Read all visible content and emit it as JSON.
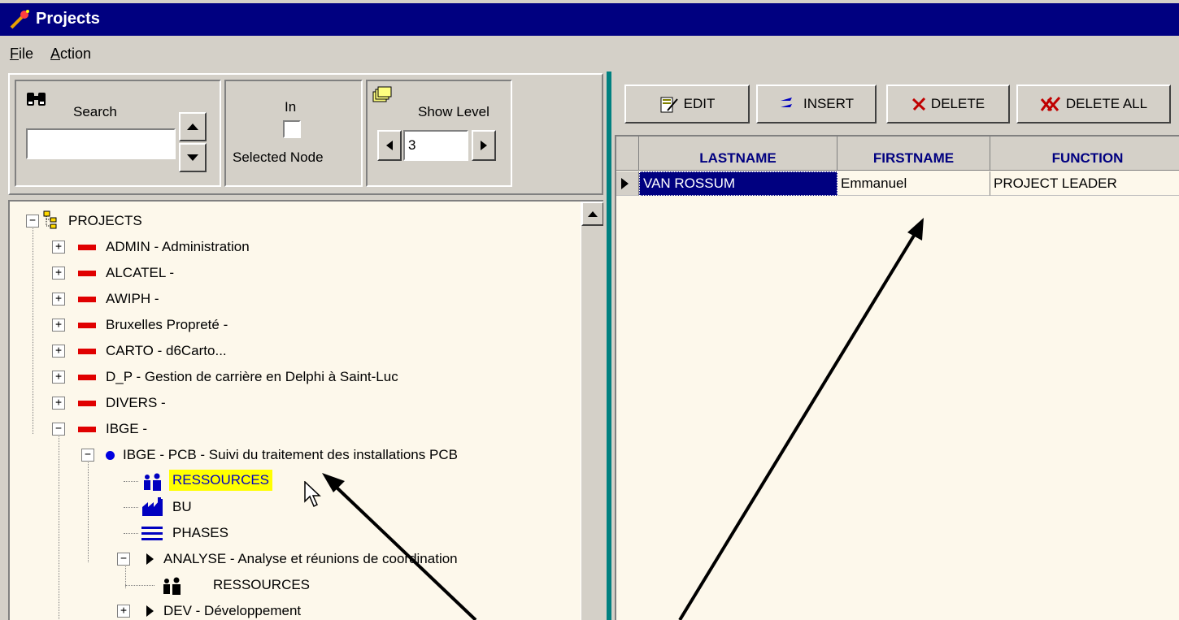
{
  "window": {
    "title": "Projects"
  },
  "menu": {
    "file": "File",
    "file_ul": "F",
    "file_rest": "ile",
    "action": "Action",
    "action_ul": "A",
    "action_rest": "ction"
  },
  "search": {
    "label": "Search",
    "value": ""
  },
  "in_selected": {
    "label_in": "In",
    "label_node": "Selected Node",
    "checked": false
  },
  "show_level": {
    "label": "Show Level",
    "value": "3"
  },
  "toolbar": {
    "edit": "EDIT",
    "insert": "INSERT",
    "delete": "DELETE",
    "delete_all": "DELETE ALL"
  },
  "grid": {
    "columns": [
      "LASTNAME",
      "FIRSTNAME",
      "FUNCTION"
    ],
    "rows": [
      {
        "lastname": "VAN ROSSUM",
        "firstname": "Emmanuel",
        "function": "PROJECT LEADER"
      }
    ]
  },
  "tree": {
    "root": "PROJECTS",
    "items": [
      {
        "label": "ADMIN - Administration"
      },
      {
        "label": "ALCATEL -"
      },
      {
        "label": "AWIPH -"
      },
      {
        "label": "Bruxelles Propreté -"
      },
      {
        "label": "CARTO - d6Carto..."
      },
      {
        "label": "D_P - Gestion de carrière en Delphi à Saint-Luc"
      },
      {
        "label": "DIVERS -"
      },
      {
        "label": "IBGE -"
      }
    ],
    "sub_project": "IBGE - PCB - Suivi du traitement des installations PCB",
    "resources": "RESSOURCES",
    "bu": "BU",
    "phases": "PHASES",
    "analyse": "ANALYSE - Analyse et réunions de coordination",
    "analyse_resources": "RESSOURCES",
    "dev": "DEV - Développement"
  },
  "colors": {
    "title_bar": "#000080",
    "highlight": "#ffff00",
    "accent_red": "#e00000",
    "splitter": "#008080"
  }
}
